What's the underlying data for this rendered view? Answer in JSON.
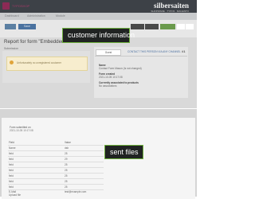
{
  "app": {
    "title": "TYPOSHOP",
    "brand": "silbersaiten",
    "brand_tagline": "SHOPWARE · TYPO3 · MAGENTO"
  },
  "menu": [
    "Dashboard",
    "Administration",
    "Module"
  ],
  "toolbar": {
    "button_label": "Save"
  },
  "report_title": "Report for form \"Embedded form\"",
  "submission_label": "Submission",
  "warning_text": "Unfortunately no unregistered customer",
  "customer_panel": {
    "tab": "Guest",
    "link": "CONTACT THIS PERSON VIA ANY CHANNEL",
    "count": "#1",
    "fields": [
      {
        "label": "Name",
        "value": "Contact Form Mason (Is not changed)"
      },
      {
        "label": "Form created",
        "value": "2021-10-05 10:17:08"
      },
      {
        "label": "Currently associated to products",
        "value": "No associations"
      }
    ]
  },
  "badges": {
    "customer": "customer information",
    "files": "sent files"
  },
  "submission": {
    "submitted_label": "Form submitted on",
    "submitted_value": "2021-10-05 10:17:08",
    "header_field": "Field",
    "header_value": "Value",
    "rows": [
      {
        "field": "Name",
        "value": "dsb"
      },
      {
        "field": "field",
        "value": "25"
      },
      {
        "field": "field",
        "value": "29"
      },
      {
        "field": "field",
        "value": "25"
      },
      {
        "field": "field",
        "value": "25"
      },
      {
        "field": "field",
        "value": "25"
      },
      {
        "field": "field",
        "value": "25"
      },
      {
        "field": "field",
        "value": "25"
      },
      {
        "field": "E-Mail",
        "value": "test@example.com"
      },
      {
        "field": "Upload file",
        "value": ""
      }
    ]
  }
}
